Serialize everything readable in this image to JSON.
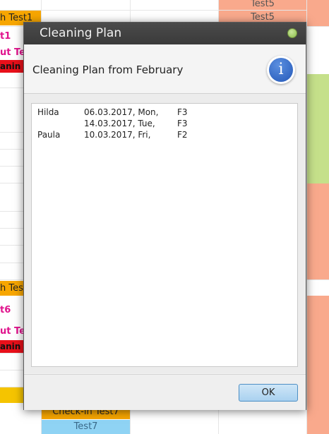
{
  "background": {
    "left_column": [
      {
        "text": "h Test1",
        "style": "orange"
      },
      {
        "text": "t1",
        "style": "pinktext"
      },
      {
        "text": "ut Te",
        "style": "pinktext"
      },
      {
        "text": "anin",
        "style": "red"
      },
      {
        "text": "h Test",
        "style": "orange"
      },
      {
        "text": "t6",
        "style": "pinktext"
      },
      {
        "text": "ut Te",
        "style": "pinktext"
      },
      {
        "text": "anin",
        "style": "red"
      }
    ],
    "right_top": [
      "Test5",
      "Test5"
    ],
    "bottom_bar": {
      "checkin": "Check-in Test7",
      "guest": "Test7"
    }
  },
  "dialog": {
    "title": "Cleaning Plan",
    "header": "Cleaning Plan from February",
    "info_icon": "i",
    "rows": [
      {
        "name": "Hilda",
        "date": "06.03.2017, Mon,",
        "room": "F3"
      },
      {
        "name": "",
        "date": "14.03.2017, Tue,",
        "room": "F3"
      },
      {
        "name": "Paula",
        "date": "10.03.2017, Fri,",
        "room": "F2"
      }
    ],
    "ok_label": "OK"
  },
  "colors": {
    "orange": "#f7a600",
    "salmon": "#f9a98c",
    "green": "#c5e08a",
    "sky_blue": "#8fd3f4",
    "pink_text": "#e0138c",
    "red": "#e8101a",
    "title_bar": "#3a3a3a"
  }
}
